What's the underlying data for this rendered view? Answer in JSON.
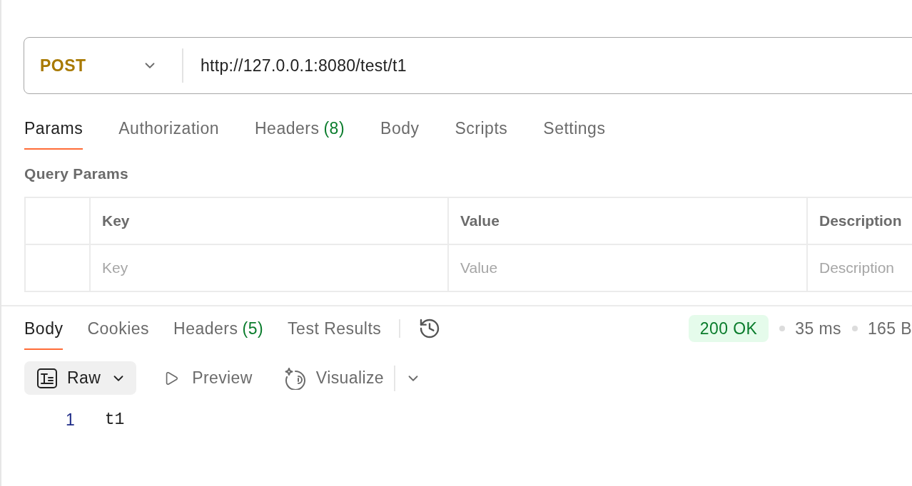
{
  "request": {
    "method": "POST",
    "url": "http://127.0.0.1:8080/test/t1"
  },
  "request_tabs": [
    {
      "label": "Params",
      "selected": true
    },
    {
      "label": "Authorization",
      "selected": false
    },
    {
      "label": "Headers",
      "count": "(8)",
      "selected": false
    },
    {
      "label": "Body",
      "selected": false
    },
    {
      "label": "Scripts",
      "selected": false
    },
    {
      "label": "Settings",
      "selected": false
    }
  ],
  "query_params": {
    "title": "Query Params",
    "columns": [
      "Key",
      "Value",
      "Description"
    ],
    "rows": [
      {
        "key": {
          "placeholder": "Key"
        },
        "value": {
          "placeholder": "Value"
        },
        "description": {
          "placeholder": "Description"
        }
      }
    ]
  },
  "response": {
    "tabs": [
      {
        "label": "Body",
        "selected": true
      },
      {
        "label": "Cookies",
        "selected": false
      },
      {
        "label": "Headers",
        "count": "(5)",
        "selected": false
      },
      {
        "label": "Test Results",
        "selected": false
      }
    ],
    "status": "200 OK",
    "time": "35 ms",
    "size": "165 B",
    "view_modes": [
      {
        "label": "Raw",
        "kind": "dropdown",
        "selected": true
      },
      {
        "label": "Preview",
        "kind": "preview",
        "selected": false
      },
      {
        "label": "Visualize",
        "kind": "visualize",
        "selected": false
      }
    ],
    "lines": [
      {
        "number": "1",
        "text": "t1"
      }
    ]
  }
}
